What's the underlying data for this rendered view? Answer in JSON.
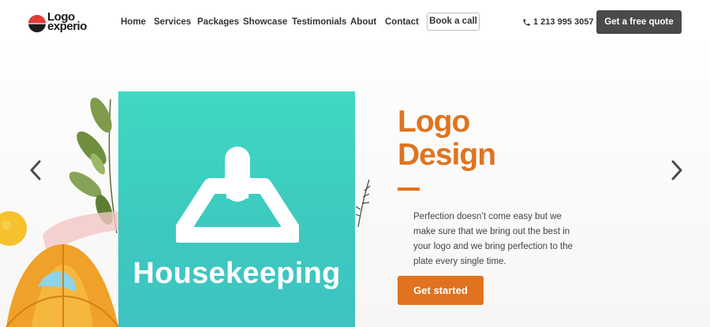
{
  "brand": {
    "line1": "Logo",
    "line2": "experio",
    "accent": "#e0731f",
    "dark": "#4a4a4a",
    "teal": "#3fd8c2"
  },
  "nav": {
    "items": [
      {
        "label": "Home"
      },
      {
        "label": "Services"
      },
      {
        "label": "Packages"
      },
      {
        "label": "Showcase"
      },
      {
        "label": "Testimonials"
      },
      {
        "label": "About"
      },
      {
        "label": "Contact"
      }
    ],
    "book_label": "Book a call"
  },
  "header": {
    "phone_icon": "phone-icon",
    "phone": "1 213 995 3057",
    "quote_label": "Get a free quote"
  },
  "slider": {
    "prev_icon": "chevron-left-icon",
    "next_icon": "chevron-right-icon",
    "card": {
      "icon": "broom-icon",
      "label": "Housekeeping"
    },
    "title_line1": "Logo",
    "title_line2": "Design",
    "description": "Perfection doesn’t come easy but we make sure that we bring out the best in your logo and we bring perfection to the plate every single time.",
    "cta_label": "Get started"
  }
}
